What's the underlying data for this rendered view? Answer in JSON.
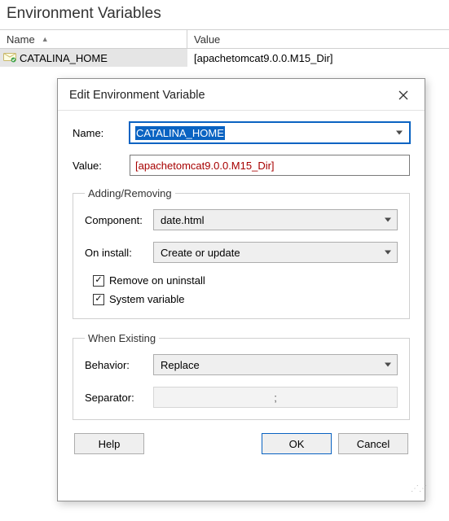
{
  "page": {
    "title": "Environment Variables"
  },
  "grid": {
    "columns": {
      "name": "Name",
      "value": "Value"
    },
    "rows": [
      {
        "name": "CATALINA_HOME",
        "value": "[apachetomcat9.0.0.M15_Dir]"
      }
    ]
  },
  "dialog": {
    "title": "Edit Environment Variable",
    "fields": {
      "name_label": "Name:",
      "name_value": "CATALINA_HOME",
      "value_label": "Value:",
      "value_value": "[apachetomcat9.0.0.M15_Dir]"
    },
    "adding_removing": {
      "legend": "Adding/Removing",
      "component_label": "Component:",
      "component_value": "date.html",
      "on_install_label": "On install:",
      "on_install_value": "Create or update",
      "remove_on_uninstall_label": "Remove on uninstall",
      "remove_on_uninstall_checked": true,
      "system_variable_label": "System variable",
      "system_variable_checked": true
    },
    "when_existing": {
      "legend": "When Existing",
      "behavior_label": "Behavior:",
      "behavior_value": "Replace",
      "separator_label": "Separator:",
      "separator_value": ";"
    },
    "buttons": {
      "help": "Help",
      "ok": "OK",
      "cancel": "Cancel"
    }
  }
}
